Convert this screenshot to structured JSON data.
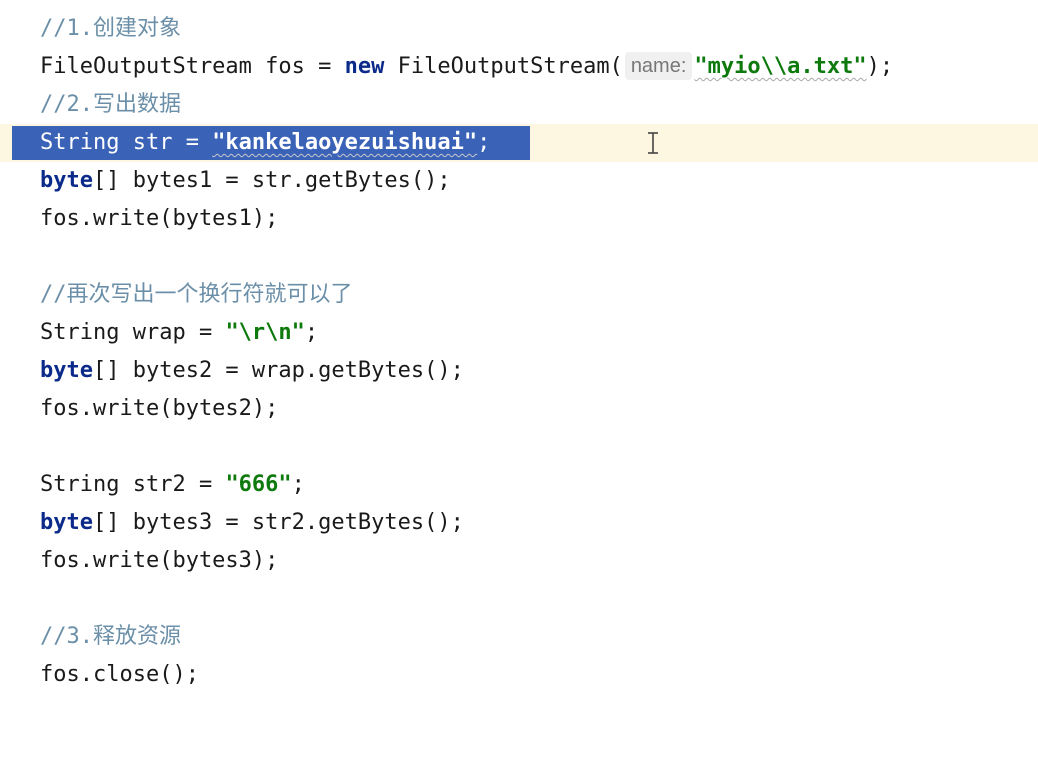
{
  "code": {
    "line1_comment": "//1.创建对象",
    "line2_class": "FileOutputStream",
    "line2_var": " fos = ",
    "line2_new": "new",
    "line2_ctor": " FileOutputStream(",
    "line2_hint": "name:",
    "line2_string": "\"myio\\\\a.txt\"",
    "line2_end": ");",
    "line3_comment": "//2.写出数据",
    "line4_text": "String str = ",
    "line4_string": "\"kankelaoyezuishuai\"",
    "line4_end": ";",
    "line5_kw": "byte",
    "line5_rest": "[] bytes1 = str.getBytes();",
    "line6": "fos.write(bytes1);",
    "line8_comment": "//再次写出一个换行符就可以了",
    "line9_text": "String wrap = ",
    "line9_string": "\"\\r\\n\"",
    "line9_end": ";",
    "line10_kw": "byte",
    "line10_rest": "[] bytes2 = wrap.getBytes();",
    "line11": "fos.write(bytes2);",
    "line13_text": "String str2 = ",
    "line13_string": "\"666\"",
    "line13_end": ";",
    "line14_kw": "byte",
    "line14_rest": "[] bytes3 = str2.getBytes();",
    "line15": "fos.write(bytes3);",
    "line17_comment": "//3.释放资源",
    "line18": "fos.close();"
  },
  "colors": {
    "keyword": "#0b2a8a",
    "string": "#0e7a0e",
    "comment": "#6b8fa8",
    "selection": "#3a63b8",
    "current_line": "#fdf6e0"
  },
  "cursor_icon": "text-ibeam-icon"
}
